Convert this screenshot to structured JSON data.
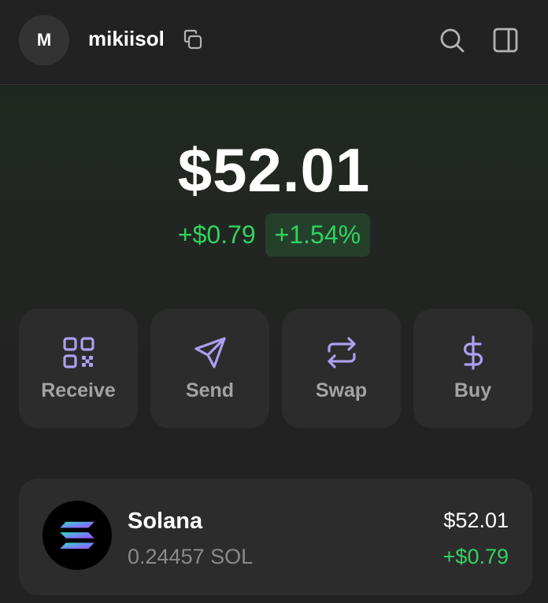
{
  "header": {
    "avatar_initial": "M",
    "username": "mikiisol",
    "icons": [
      "copy-icon",
      "search-icon",
      "sidebar-panel-icon"
    ]
  },
  "portfolio": {
    "balance": "$52.01",
    "change_amount": "+$0.79",
    "change_percent": "+1.54%"
  },
  "actions": [
    {
      "label": "Receive",
      "icon": "qr-code-icon"
    },
    {
      "label": "Send",
      "icon": "send-icon"
    },
    {
      "label": "Swap",
      "icon": "swap-icon"
    },
    {
      "label": "Buy",
      "icon": "dollar-icon"
    }
  ],
  "tokens": [
    {
      "name": "Solana",
      "amount": "0.24457 SOL",
      "value": "$52.01",
      "change": "+$0.79",
      "icon": "solana-logo-icon"
    }
  ],
  "colors": {
    "background": "#222222",
    "accent_purple": "#ab9ff2",
    "positive_green": "#2fd45f",
    "card": "#2c2c2c"
  }
}
